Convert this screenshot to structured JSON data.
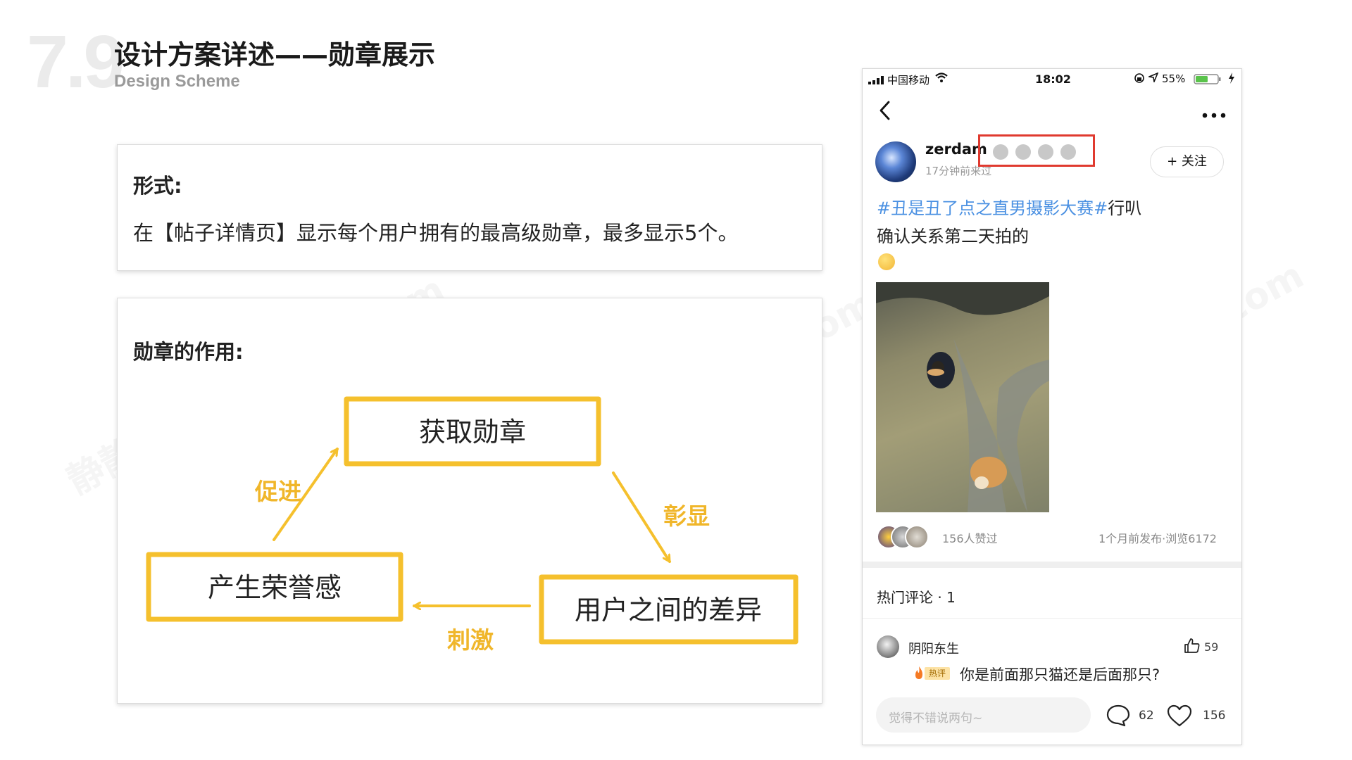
{
  "header": {
    "section_number": "7.9",
    "title": "设计方案详述——勋章展示",
    "subtitle": "Design Scheme"
  },
  "form_card": {
    "heading": "形式:",
    "text": "在【帖子详情页】显示每个用户拥有的最高级勋章，最多显示5个。"
  },
  "role_card": {
    "heading": "勋章的作用:",
    "nodes": {
      "top": "获取勋章",
      "left": "产生荣誉感",
      "right": "用户之间的差异"
    },
    "edges": {
      "promote": "促进",
      "highlight": "彰显",
      "stimulate": "刺激"
    },
    "box_color": "#f5c02d",
    "label_color": "#f0b62a"
  },
  "phone": {
    "status": {
      "carrier": "中国移动",
      "time": "18:02",
      "battery": "55%"
    },
    "post": {
      "username": "zerdam",
      "time_ago": "17分钟前来过",
      "follow_label": "+ 关注",
      "hashtag": "#丑是丑了点之直男摄影大赛#",
      "text_after_hashtag": "行叭",
      "text_line2": "确认关系第二天拍的",
      "badge_count": 4,
      "likes": "156人赞过",
      "meta": "1个月前发布·浏览6172"
    },
    "comments": {
      "heading": "热门评论 · 1",
      "items": [
        {
          "author": "阴阳东生",
          "likes": "59",
          "tag": "热评",
          "text": "你是前面那只猫还是后面那只?"
        }
      ]
    },
    "bottom_bar": {
      "input_placeholder": "觉得不错说两句~",
      "comment_count": "62",
      "like_count": "156"
    },
    "colors": {
      "hashtag": "#4a90e2",
      "highlight_box": "#e03a2f",
      "badge": "#c8c8c8"
    }
  },
  "watermark": "静静原创 pmecho.com"
}
